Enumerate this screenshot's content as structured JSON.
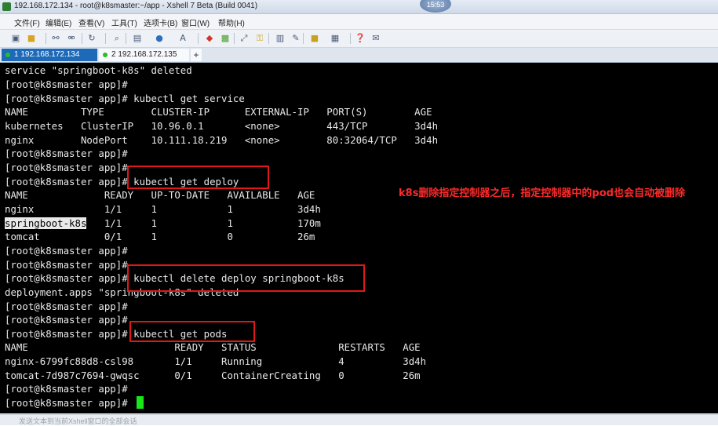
{
  "window": {
    "title": "192.168.172.134 - root@k8smaster:~/app - Xshell 7 Beta (Build 0041)",
    "clock": "15:53"
  },
  "menu": [
    "文件(F)",
    "编辑(E)",
    "查看(V)",
    "工具(T)",
    "选项卡(B)",
    "窗口(W)",
    "帮助(H)"
  ],
  "toolbar_icons": [
    "new-session-icon",
    "open-folder-icon",
    "connect-icon",
    "disconnect-icon",
    "reconnect-icon",
    "copy-icon",
    "paste-icon",
    "find-icon",
    "session-manager-icon",
    "color-scheme-icon",
    "font-icon",
    "xftp-icon",
    "lock-icon",
    "fullscreen-icon",
    "transparency-icon",
    "highlight-icon",
    "script-icon",
    "layout-icon",
    "help-icon",
    "chat-icon"
  ],
  "tabs": [
    {
      "label": "1 192.168.172.134",
      "active": true
    },
    {
      "label": "2 192.168.172.135",
      "active": false
    }
  ],
  "terminal": {
    "lines": [
      "service \"springboot-k8s\" deleted",
      "[root@k8smaster app]#",
      "[root@k8smaster app]# kubectl get service",
      "NAME         TYPE        CLUSTER-IP      EXTERNAL-IP   PORT(S)        AGE",
      "kubernetes   ClusterIP   10.96.0.1       <none>        443/TCP        3d4h",
      "nginx        NodePort    10.111.18.219   <none>        80:32064/TCP   3d4h",
      "[root@k8smaster app]#",
      "[root@k8smaster app]#",
      "[root@k8smaster app]# kubectl get deploy",
      "NAME             READY   UP-TO-DATE   AVAILABLE   AGE",
      "nginx            1/1     1            1           3d4h",
      "springboot-k8s   1/1     1            1           170m",
      "tomcat           0/1     1            0           26m",
      "[root@k8smaster app]#",
      "[root@k8smaster app]#",
      "[root@k8smaster app]# kubectl delete deploy springboot-k8s",
      "deployment.apps \"springboot-k8s\" deleted",
      "[root@k8smaster app]#",
      "[root@k8smaster app]#",
      "[root@k8smaster app]# kubectl get pods",
      "NAME                         READY   STATUS              RESTARTS   AGE",
      "nginx-6799fc88d8-csl98       1/1     Running             4          3d4h",
      "tomcat-7d987c7694-gwqsc      0/1     ContainerCreating   0          26m",
      "[root@k8smaster app]#",
      "[root@k8smaster app]# "
    ],
    "highlighted_text": "springboot-k8s"
  },
  "annotation": "k8s删除指定控制器之后，指定控制器中的pod也会自动被删除",
  "status_bar": "发送文本到当前Xshell窗口的全部会话"
}
